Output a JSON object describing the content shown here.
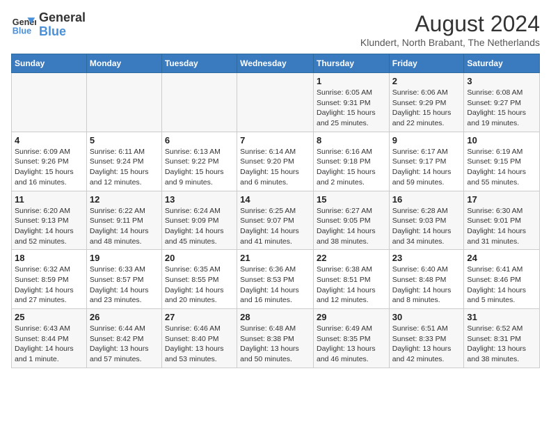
{
  "header": {
    "logo_line1": "General",
    "logo_line2": "Blue",
    "month_title": "August 2024",
    "subtitle": "Klundert, North Brabant, The Netherlands"
  },
  "days_of_week": [
    "Sunday",
    "Monday",
    "Tuesday",
    "Wednesday",
    "Thursday",
    "Friday",
    "Saturday"
  ],
  "weeks": [
    [
      {
        "day": "",
        "info": ""
      },
      {
        "day": "",
        "info": ""
      },
      {
        "day": "",
        "info": ""
      },
      {
        "day": "",
        "info": ""
      },
      {
        "day": "1",
        "info": "Sunrise: 6:05 AM\nSunset: 9:31 PM\nDaylight: 15 hours and 25 minutes."
      },
      {
        "day": "2",
        "info": "Sunrise: 6:06 AM\nSunset: 9:29 PM\nDaylight: 15 hours and 22 minutes."
      },
      {
        "day": "3",
        "info": "Sunrise: 6:08 AM\nSunset: 9:27 PM\nDaylight: 15 hours and 19 minutes."
      }
    ],
    [
      {
        "day": "4",
        "info": "Sunrise: 6:09 AM\nSunset: 9:26 PM\nDaylight: 15 hours and 16 minutes."
      },
      {
        "day": "5",
        "info": "Sunrise: 6:11 AM\nSunset: 9:24 PM\nDaylight: 15 hours and 12 minutes."
      },
      {
        "day": "6",
        "info": "Sunrise: 6:13 AM\nSunset: 9:22 PM\nDaylight: 15 hours and 9 minutes."
      },
      {
        "day": "7",
        "info": "Sunrise: 6:14 AM\nSunset: 9:20 PM\nDaylight: 15 hours and 6 minutes."
      },
      {
        "day": "8",
        "info": "Sunrise: 6:16 AM\nSunset: 9:18 PM\nDaylight: 15 hours and 2 minutes."
      },
      {
        "day": "9",
        "info": "Sunrise: 6:17 AM\nSunset: 9:17 PM\nDaylight: 14 hours and 59 minutes."
      },
      {
        "day": "10",
        "info": "Sunrise: 6:19 AM\nSunset: 9:15 PM\nDaylight: 14 hours and 55 minutes."
      }
    ],
    [
      {
        "day": "11",
        "info": "Sunrise: 6:20 AM\nSunset: 9:13 PM\nDaylight: 14 hours and 52 minutes."
      },
      {
        "day": "12",
        "info": "Sunrise: 6:22 AM\nSunset: 9:11 PM\nDaylight: 14 hours and 48 minutes."
      },
      {
        "day": "13",
        "info": "Sunrise: 6:24 AM\nSunset: 9:09 PM\nDaylight: 14 hours and 45 minutes."
      },
      {
        "day": "14",
        "info": "Sunrise: 6:25 AM\nSunset: 9:07 PM\nDaylight: 14 hours and 41 minutes."
      },
      {
        "day": "15",
        "info": "Sunrise: 6:27 AM\nSunset: 9:05 PM\nDaylight: 14 hours and 38 minutes."
      },
      {
        "day": "16",
        "info": "Sunrise: 6:28 AM\nSunset: 9:03 PM\nDaylight: 14 hours and 34 minutes."
      },
      {
        "day": "17",
        "info": "Sunrise: 6:30 AM\nSunset: 9:01 PM\nDaylight: 14 hours and 31 minutes."
      }
    ],
    [
      {
        "day": "18",
        "info": "Sunrise: 6:32 AM\nSunset: 8:59 PM\nDaylight: 14 hours and 27 minutes."
      },
      {
        "day": "19",
        "info": "Sunrise: 6:33 AM\nSunset: 8:57 PM\nDaylight: 14 hours and 23 minutes."
      },
      {
        "day": "20",
        "info": "Sunrise: 6:35 AM\nSunset: 8:55 PM\nDaylight: 14 hours and 20 minutes."
      },
      {
        "day": "21",
        "info": "Sunrise: 6:36 AM\nSunset: 8:53 PM\nDaylight: 14 hours and 16 minutes."
      },
      {
        "day": "22",
        "info": "Sunrise: 6:38 AM\nSunset: 8:51 PM\nDaylight: 14 hours and 12 minutes."
      },
      {
        "day": "23",
        "info": "Sunrise: 6:40 AM\nSunset: 8:48 PM\nDaylight: 14 hours and 8 minutes."
      },
      {
        "day": "24",
        "info": "Sunrise: 6:41 AM\nSunset: 8:46 PM\nDaylight: 14 hours and 5 minutes."
      }
    ],
    [
      {
        "day": "25",
        "info": "Sunrise: 6:43 AM\nSunset: 8:44 PM\nDaylight: 14 hours and 1 minute."
      },
      {
        "day": "26",
        "info": "Sunrise: 6:44 AM\nSunset: 8:42 PM\nDaylight: 13 hours and 57 minutes."
      },
      {
        "day": "27",
        "info": "Sunrise: 6:46 AM\nSunset: 8:40 PM\nDaylight: 13 hours and 53 minutes."
      },
      {
        "day": "28",
        "info": "Sunrise: 6:48 AM\nSunset: 8:38 PM\nDaylight: 13 hours and 50 minutes."
      },
      {
        "day": "29",
        "info": "Sunrise: 6:49 AM\nSunset: 8:35 PM\nDaylight: 13 hours and 46 minutes."
      },
      {
        "day": "30",
        "info": "Sunrise: 6:51 AM\nSunset: 8:33 PM\nDaylight: 13 hours and 42 minutes."
      },
      {
        "day": "31",
        "info": "Sunrise: 6:52 AM\nSunset: 8:31 PM\nDaylight: 13 hours and 38 minutes."
      }
    ]
  ]
}
